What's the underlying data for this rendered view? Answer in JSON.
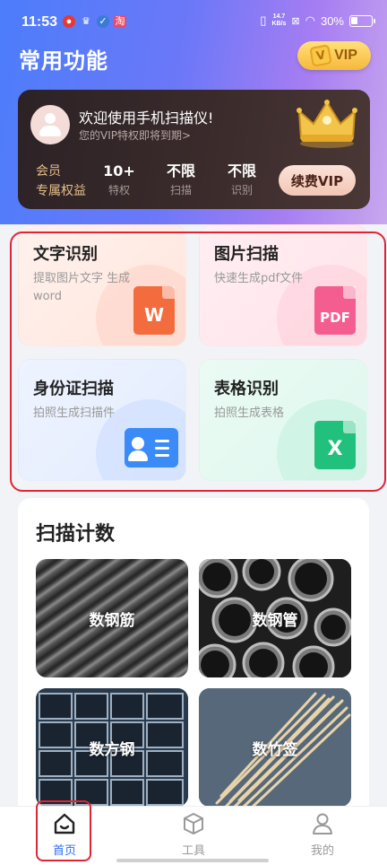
{
  "status_bar": {
    "time": "11:53",
    "net_speed_value": "14.7",
    "net_speed_unit": "KB/s",
    "battery": "30%"
  },
  "header": {
    "title": "常用功能",
    "vip_badge": "VIP"
  },
  "vip_card": {
    "welcome": "欢迎使用手机扫描仪!",
    "subtitle": "您的VIP特权即将到期>",
    "member_line1": "会员",
    "member_line2": "专属权益",
    "stats": [
      {
        "value": "10+",
        "label": "特权"
      },
      {
        "value": "不限",
        "label": "扫描"
      },
      {
        "value": "不限",
        "label": "识别"
      }
    ],
    "renew_button": "续费VIP"
  },
  "functions": [
    {
      "title": "文字识别",
      "desc": "提取图片文字 生成word",
      "icon": "word-doc-icon",
      "icon_text": "W",
      "color": "#f36c3d"
    },
    {
      "title": "图片扫描",
      "desc": "快速生成pdf文件",
      "icon": "pdf-doc-icon",
      "icon_text": "PDF",
      "color": "#f45d8f"
    },
    {
      "title": "身份证扫描",
      "desc": "拍照生成扫描件",
      "icon": "id-card-icon",
      "color": "#3a8bf7"
    },
    {
      "title": "表格识别",
      "desc": "拍照生成表格",
      "icon": "excel-doc-icon",
      "icon_text": "X",
      "color": "#21c07d"
    }
  ],
  "scan_count": {
    "title": "扫描计数",
    "tiles": [
      {
        "label": "数钢筋",
        "image": "steel-rebar-photo"
      },
      {
        "label": "数钢管",
        "image": "steel-pipe-photo"
      },
      {
        "label": "数方钢",
        "image": "square-steel-photo"
      },
      {
        "label": "数竹签",
        "image": "bamboo-sticks-photo"
      }
    ]
  },
  "bottom_nav": [
    {
      "label": "首页",
      "icon": "home-icon",
      "active": true
    },
    {
      "label": "工具",
      "icon": "box-icon",
      "active": false
    },
    {
      "label": "我的",
      "icon": "user-icon",
      "active": false
    }
  ],
  "colors": {
    "accent": "#2b6ff6",
    "highlight": "#e02433",
    "gold": "#e6bf8a"
  }
}
